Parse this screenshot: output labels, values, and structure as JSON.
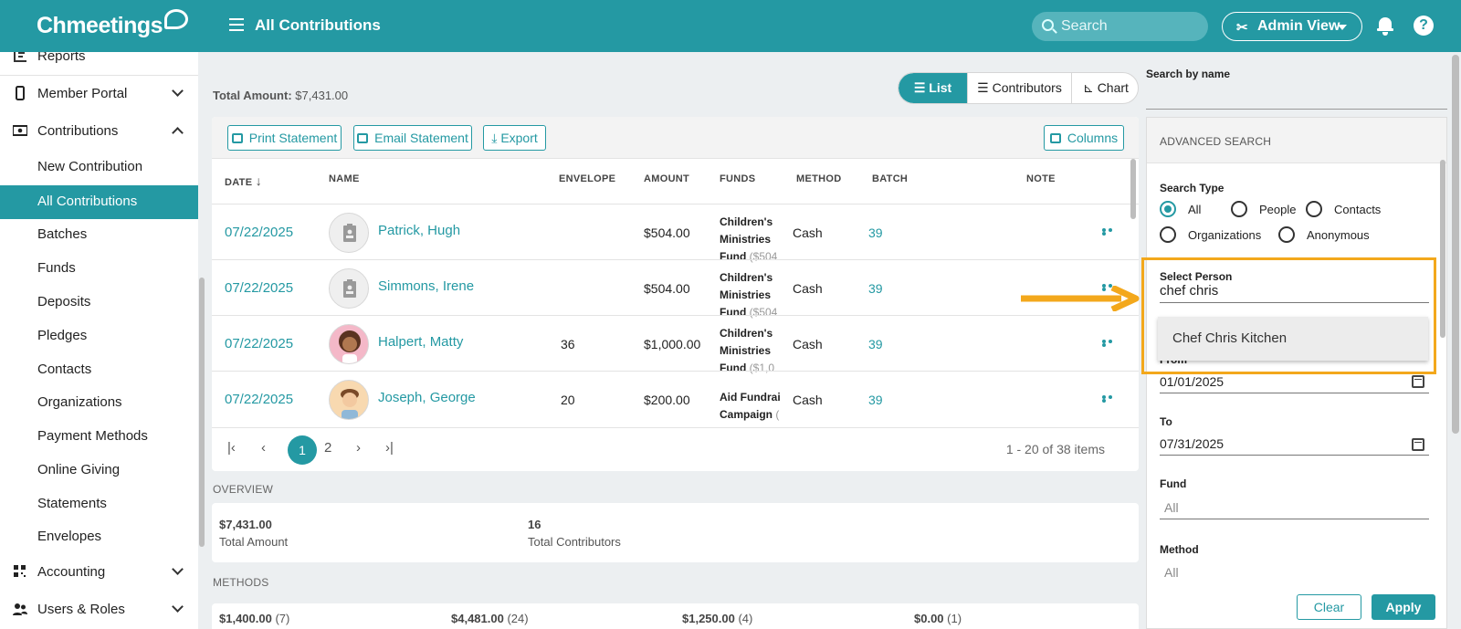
{
  "header": {
    "logo": "Chmeetings",
    "title": "All Contributions",
    "search_placeholder": "Search",
    "admin_view": "Admin View"
  },
  "sidebar": {
    "items": [
      {
        "label": "Reports",
        "icon": "report-icon"
      },
      {
        "label": "Member Portal",
        "icon": "phone-icon"
      },
      {
        "label": "Contributions",
        "icon": "money-icon"
      },
      {
        "label": "New Contribution"
      },
      {
        "label": "All Contributions"
      },
      {
        "label": "Batches"
      },
      {
        "label": "Funds"
      },
      {
        "label": "Deposits"
      },
      {
        "label": "Pledges"
      },
      {
        "label": "Contacts"
      },
      {
        "label": "Organizations"
      },
      {
        "label": "Payment Methods"
      },
      {
        "label": "Online Giving"
      },
      {
        "label": "Statements"
      },
      {
        "label": "Envelopes"
      },
      {
        "label": "Accounting",
        "icon": "grid-icon"
      },
      {
        "label": "Users & Roles",
        "icon": "users-icon"
      }
    ]
  },
  "main": {
    "total_amount_label": "Total Amount:",
    "total_amount_value": "$7,431.00",
    "view_tabs": [
      "List",
      "Contributors",
      "Chart"
    ],
    "toolbar": {
      "print": "Print Statement",
      "email": "Email Statement",
      "export": "Export",
      "columns": "Columns"
    },
    "columns": [
      "DATE",
      "NAME",
      "ENVELOPE",
      "AMOUNT",
      "FUNDS",
      "METHOD",
      "BATCH",
      "NOTE"
    ],
    "rows": [
      {
        "date": "07/22/2025",
        "name": "Patrick, Hugh",
        "envelope": "",
        "amount": "$504.00",
        "funds": [
          "Children's",
          "Ministries",
          "Fund"
        ],
        "funds_paren": " ($504",
        "method": "Cash",
        "batch": "39"
      },
      {
        "date": "07/22/2025",
        "name": "Simmons, Irene",
        "envelope": "",
        "amount": "$504.00",
        "funds": [
          "Children's",
          "Ministries",
          "Fund"
        ],
        "funds_paren": " ($504",
        "method": "Cash",
        "batch": "39"
      },
      {
        "date": "07/22/2025",
        "name": "Halpert, Matty",
        "envelope": "36",
        "amount": "$1,000.00",
        "funds": [
          "Children's",
          "Ministries",
          "Fund"
        ],
        "funds_paren": " ($1,0",
        "method": "Cash",
        "batch": "39"
      },
      {
        "date": "07/22/2025",
        "name": "Joseph, George",
        "envelope": "20",
        "amount": "$200.00",
        "funds": [
          "Aid Fundrai",
          "Campaign"
        ],
        "funds_paren": " (",
        "method": "Cash",
        "batch": "39"
      }
    ],
    "pager": {
      "pages": [
        "1",
        "2"
      ],
      "info": "1 - 20 of 38 items"
    },
    "overview": {
      "label": "OVERVIEW",
      "total_amount": "$7,431.00",
      "total_amount_label": "Total Amount",
      "total_contributors": "16",
      "total_contributors_label": "Total Contributors"
    },
    "methods": {
      "label": "METHODS",
      "items": [
        {
          "value": "$1,400.00",
          "count": "(7)"
        },
        {
          "value": "$4,481.00",
          "count": "(24)"
        },
        {
          "value": "$1,250.00",
          "count": "(4)"
        },
        {
          "value": "$0.00",
          "count": "(1)"
        }
      ]
    }
  },
  "panel": {
    "search_by_name_label": "Search by name",
    "advanced_search": "ADVANCED SEARCH",
    "search_type_label": "Search Type",
    "search_types": [
      "All",
      "People",
      "Contacts",
      "Organizations",
      "Anonymous"
    ],
    "selected_type": "All",
    "select_person_label": "Select Person",
    "select_person_value": "chef chris",
    "dropdown_option": "Chef Chris Kitchen",
    "from_label": "From",
    "from_value": "01/01/2025",
    "to_label": "To",
    "to_value": "07/31/2025",
    "fund_label": "Fund",
    "fund_placeholder": "All",
    "method_label": "Method",
    "method_placeholder": "All",
    "clear": "Clear",
    "apply": "Apply"
  },
  "colors": {
    "accent": "#2499a3",
    "highlight": "#f3a81c"
  }
}
